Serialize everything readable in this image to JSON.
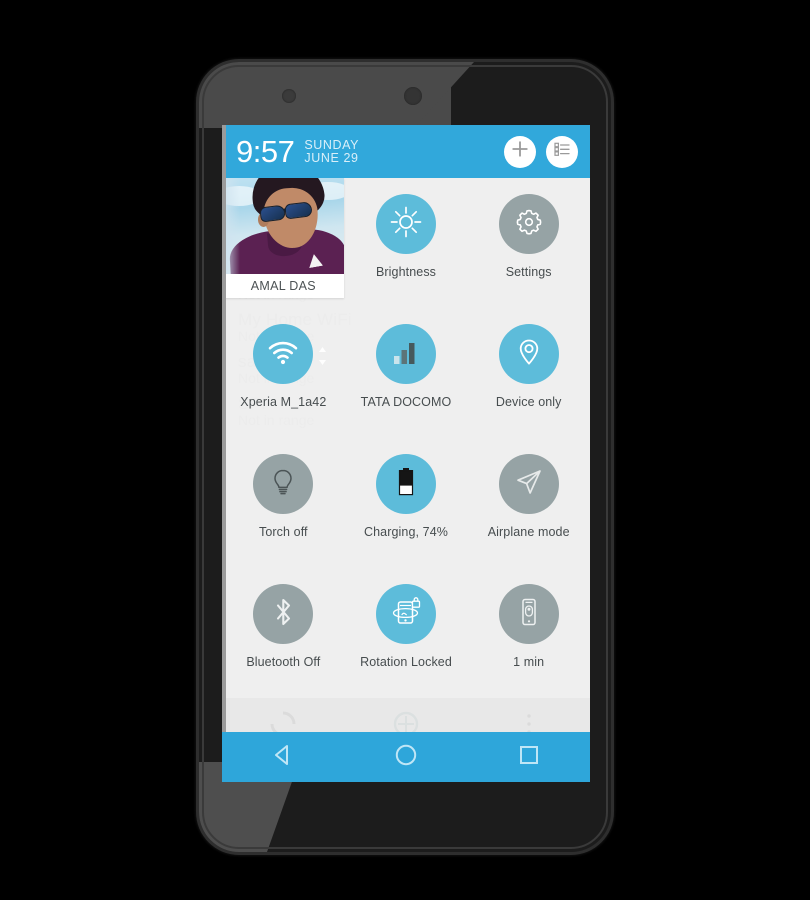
{
  "header": {
    "time": "9:57",
    "day": "SUNDAY",
    "date": "JUNE 29",
    "add_icon": "plus-icon",
    "list_icon": "list-icon"
  },
  "profile": {
    "name": "AMAL DAS"
  },
  "toggles": [
    {
      "id": "brightness",
      "label": "Brightness",
      "icon": "brightness-sun-icon",
      "state": "on"
    },
    {
      "id": "settings",
      "label": "Settings",
      "icon": "gear-icon",
      "state": "off"
    },
    {
      "id": "wifi",
      "label": "Xperia M_1a42",
      "icon": "wifi-icon",
      "state": "on"
    },
    {
      "id": "mobiledata",
      "label": "TATA DOCOMO",
      "icon": "signal-bars-icon",
      "state": "on"
    },
    {
      "id": "location",
      "label": "Device only",
      "icon": "location-pin-icon",
      "state": "on"
    },
    {
      "id": "torch",
      "label": "Torch off",
      "icon": "lightbulb-icon",
      "state": "off"
    },
    {
      "id": "battery",
      "label": "Charging, 74%",
      "icon": "battery-icon",
      "state": "on"
    },
    {
      "id": "airplane",
      "label": "Airplane mode",
      "icon": "airplane-icon",
      "state": "off"
    },
    {
      "id": "bluetooth",
      "label": "Bluetooth Off",
      "icon": "bluetooth-icon",
      "state": "off"
    },
    {
      "id": "rotation",
      "label": "Rotation Locked",
      "icon": "rotation-lock-icon",
      "state": "on"
    },
    {
      "id": "timeout",
      "label": "1 min",
      "icon": "screen-timeout-icon",
      "state": "off"
    }
  ],
  "background_list": [
    {
      "name": "AMAL DAS",
      "status": "Not in range"
    },
    {
      "name": "ADyVn9tYXg",
      "status": "Not in range"
    },
    {
      "name": "maniar house",
      "status": "Not in range"
    },
    {
      "name": "My Home WiFi",
      "status": "Not in range"
    },
    {
      "name": "sams'",
      "status": "Not in range"
    },
    {
      "name": "SPI",
      "status": "Not in range"
    }
  ],
  "navbar": {
    "back": "back-triangle-icon",
    "home": "home-circle-icon",
    "recents": "recents-square-icon"
  },
  "colors": {
    "header_blue": "#31a8db",
    "toggle_on": "#5dbcda",
    "toggle_off": "#96a3a5",
    "nav_blue": "#2ea6da",
    "screen_bg": "#eceded"
  }
}
